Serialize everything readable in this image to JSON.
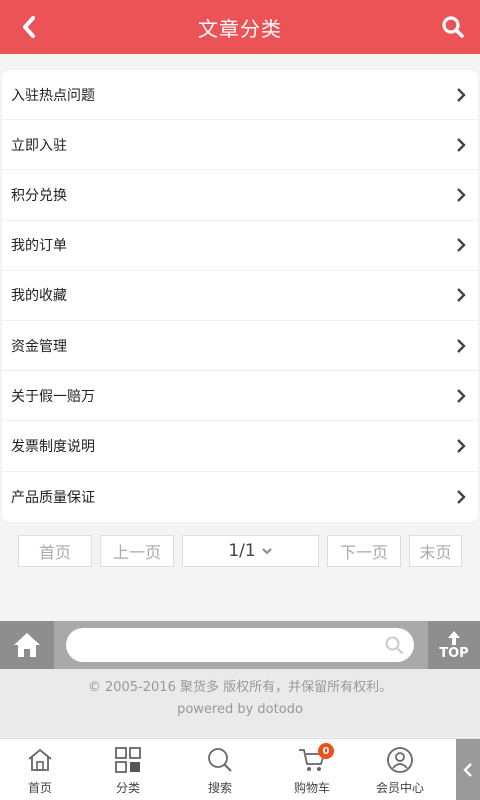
{
  "header": {
    "title": "文章分类"
  },
  "list": {
    "items": [
      {
        "label": "入驻热点问题"
      },
      {
        "label": "立即入驻"
      },
      {
        "label": "积分兑换"
      },
      {
        "label": "我的订单"
      },
      {
        "label": "我的收藏"
      },
      {
        "label": "资金管理"
      },
      {
        "label": "关于假一赔万"
      },
      {
        "label": "发票制度说明"
      },
      {
        "label": "产品质量保证"
      }
    ]
  },
  "pager": {
    "first": "首页",
    "prev": "上一页",
    "current": "1/1",
    "next": "下一页",
    "last": "末页"
  },
  "footer": {
    "search_placeholder": "",
    "top_label": "TOP",
    "copyright": "© 2005-2016 聚货多 版权所有，并保留所有权利。",
    "powered": "powered by dotodo"
  },
  "tabbar": {
    "home": "首页",
    "category": "分类",
    "search": "搜索",
    "cart": "购物车",
    "cart_count": "0",
    "member": "会员中心"
  },
  "colors": {
    "brand": "#eb5356",
    "badge": "#f04e1a"
  }
}
